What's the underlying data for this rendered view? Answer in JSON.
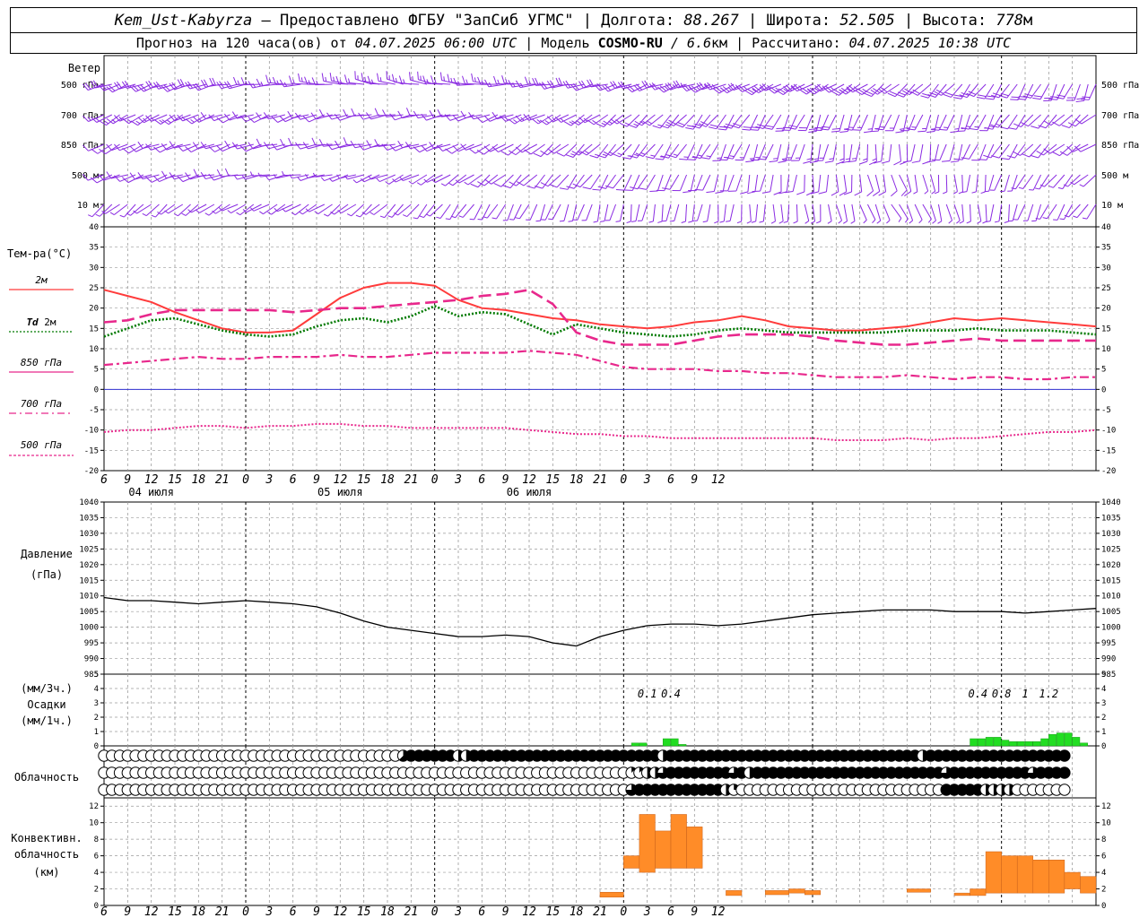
{
  "header": {
    "station": "Kem_Ust-Kabyrza",
    "sep1": " – ",
    "provider": "Предоставлено ФГБУ \"ЗапСиб УГМС\"",
    "lon_label": " | Долгота: ",
    "lon": "88.267",
    "lat_label": " | Широта: ",
    "lat": "52.505",
    "alt_label": " | Высота: ",
    "alt": "778",
    "alt_unit": "м",
    "forecast_prefix": "Прогноз на 120 часа(ов) от ",
    "forecast_time": "04.07.2025 06:00 UTC",
    "model_label": " | Модель ",
    "model": "COSMO-RU",
    "model_res": " / 6.6",
    "model_res_unit": "км",
    "calc_label": " | Рассчитано: ",
    "calc_time": "04.07.2025 10:38 UTC"
  },
  "colors": {
    "wind": "#8a2be2",
    "t2m": "#ff3b3b",
    "td2m": "#007a00",
    "t850": "#e8288c",
    "t700": "#e8288c",
    "t500": "#e8288c",
    "zero": "#3030d0",
    "pressure": "#000000",
    "precip": "#22dd22",
    "conv": "#ff8c28",
    "grid": "#9a9a9a"
  },
  "chart_data": [
    {
      "type": "wind_barbs",
      "title": "Ветер",
      "levels": [
        "500 гПа",
        "700 гПа",
        "850 гПа",
        "500 м",
        "10 м"
      ],
      "step_hours": 1,
      "direction_deg_by_level": [
        [
          250,
          250,
          260,
          270,
          280,
          280,
          270,
          260,
          250,
          250,
          240,
          240,
          230,
          220,
          210,
          200
        ],
        [
          240,
          240,
          250,
          250,
          260,
          260,
          250,
          240,
          230,
          220,
          210,
          200,
          200,
          200,
          220,
          230
        ],
        [
          240,
          250,
          250,
          260,
          260,
          250,
          240,
          230,
          220,
          210,
          200,
          190,
          180,
          200,
          220,
          240
        ],
        [
          250,
          250,
          260,
          260,
          250,
          240,
          230,
          220,
          210,
          200,
          190,
          180,
          160,
          180,
          210,
          230
        ],
        [
          230,
          230,
          240,
          240,
          230,
          220,
          210,
          200,
          190,
          190,
          180,
          170,
          150,
          170,
          200,
          220
        ]
      ],
      "speed_ms_by_level": [
        [
          10,
          10,
          9,
          8,
          8,
          7,
          8,
          9,
          10,
          12,
          13,
          12,
          11,
          10,
          9,
          9
        ],
        [
          7,
          7,
          6,
          6,
          5,
          5,
          6,
          7,
          8,
          9,
          10,
          9,
          8,
          7,
          6,
          6
        ],
        [
          5,
          5,
          5,
          4,
          4,
          4,
          5,
          6,
          7,
          7,
          8,
          7,
          6,
          5,
          4,
          4
        ],
        [
          4,
          4,
          4,
          3,
          3,
          3,
          4,
          4,
          5,
          5,
          6,
          5,
          4,
          3,
          3,
          3
        ],
        [
          2,
          2,
          2,
          2,
          2,
          2,
          2,
          3,
          3,
          3,
          3,
          3,
          2,
          2,
          2,
          2
        ]
      ]
    },
    {
      "type": "line",
      "title": "Тем-ра(°C)",
      "ylim": [
        -20,
        40
      ],
      "yticks": [
        40,
        35,
        30,
        25,
        20,
        15,
        10,
        5,
        0,
        -5,
        -10,
        -15,
        -20
      ],
      "x_hours": [
        0,
        3,
        6,
        9,
        12,
        15,
        18,
        21,
        24,
        27,
        30,
        33,
        36,
        39,
        42,
        45,
        48,
        51,
        54,
        57,
        60,
        63,
        66,
        69,
        72,
        75,
        78,
        81,
        84,
        87,
        90,
        93,
        96,
        99,
        102,
        105,
        108,
        111,
        114,
        117,
        120,
        123,
        126
      ],
      "series": [
        {
          "name": "2м",
          "style": "solid",
          "values": [
            24.5,
            23,
            21.5,
            19,
            17,
            15,
            14,
            14,
            14.5,
            18.5,
            22.5,
            25,
            26.2,
            26.2,
            25.5,
            22,
            20,
            19.5,
            18.5,
            17.5,
            17,
            16,
            15.5,
            15,
            15.5,
            16.5,
            17,
            18,
            17,
            15.5,
            15,
            14.5,
            14.5,
            15,
            15.5,
            16.5,
            17.5,
            17,
            17.5,
            17,
            16.5,
            16,
            15.5
          ]
        },
        {
          "name": "Td 2м",
          "style": "dotted",
          "values": [
            13,
            15,
            17,
            17.5,
            16,
            14.5,
            13.5,
            13,
            13.5,
            15.5,
            17,
            17.5,
            16.5,
            18,
            20.5,
            18,
            19,
            18.5,
            16,
            13.5,
            16,
            15,
            14,
            13.5,
            13,
            13.5,
            14.5,
            15,
            14.5,
            14,
            14,
            14,
            14,
            14,
            14.5,
            14.5,
            14.5,
            15,
            14.5,
            14.5,
            14.5,
            14,
            13.5
          ]
        },
        {
          "name": "850 гПа",
          "style": "longdash",
          "values": [
            16.5,
            17,
            18.5,
            19.5,
            19.5,
            19.5,
            19.5,
            19.5,
            19,
            19.5,
            20,
            20,
            20.5,
            21,
            21.5,
            22,
            23,
            23.5,
            24.5,
            21,
            14,
            12,
            11,
            11,
            11,
            12,
            13,
            13.5,
            13.5,
            13.5,
            13,
            12,
            11.5,
            11,
            11,
            11.5,
            12,
            12.5,
            12,
            12,
            12,
            12,
            12
          ]
        },
        {
          "name": "700 гПа",
          "style": "dashdot",
          "values": [
            6,
            6.5,
            7,
            7.5,
            8,
            7.5,
            7.5,
            8,
            8,
            8,
            8.5,
            8,
            8,
            8.5,
            9,
            9,
            9,
            9,
            9.5,
            9,
            8.5,
            7,
            5.5,
            5,
            5,
            5,
            4.5,
            4.5,
            4,
            4,
            3.5,
            3,
            3,
            3,
            3.5,
            3,
            2.5,
            3,
            3,
            2.5,
            2.5,
            3,
            3
          ]
        },
        {
          "name": "500 гПа",
          "style": "dotted",
          "values": [
            -10.5,
            -10,
            -10,
            -9.5,
            -9,
            -9,
            -9.5,
            -9,
            -9,
            -8.5,
            -8.5,
            -9,
            -9,
            -9.5,
            -9.5,
            -9.5,
            -9.5,
            -9.5,
            -10,
            -10.5,
            -11,
            -11,
            -11.5,
            -11.5,
            -12,
            -12,
            -12,
            -12,
            -12,
            -12,
            -12,
            -12.5,
            -12.5,
            -12.5,
            -12,
            -12.5,
            -12,
            -12,
            -11.5,
            -11,
            -10.5,
            -10.5,
            -10
          ]
        }
      ]
    },
    {
      "type": "line",
      "title": "Давление (гПа)",
      "ylim": [
        985,
        1040
      ],
      "yticks": [
        1040,
        1035,
        1030,
        1025,
        1020,
        1015,
        1010,
        1005,
        1000,
        995,
        990,
        985
      ],
      "x_hours": [
        0,
        3,
        6,
        9,
        12,
        15,
        18,
        21,
        24,
        27,
        30,
        33,
        36,
        39,
        42,
        45,
        48,
        51,
        54,
        57,
        60,
        63,
        66,
        69,
        72,
        75,
        78,
        81,
        84,
        87,
        90,
        93,
        96,
        99,
        102,
        105,
        108,
        111,
        114,
        117,
        120,
        123,
        126
      ],
      "series": [
        {
          "name": "",
          "style": "solid",
          "values": [
            1009.5,
            1008.5,
            1008.5,
            1008,
            1007.5,
            1008,
            1008.5,
            1008,
            1007.5,
            1006.5,
            1004.5,
            1002,
            1000,
            999,
            998,
            997,
            997,
            997.5,
            997,
            995,
            994,
            997,
            999,
            1000.5,
            1001,
            1001,
            1000.5,
            1001,
            1002,
            1003,
            1004,
            1004.5,
            1005,
            1005.5,
            1005.5,
            1005.5,
            1005,
            1005,
            1005,
            1004.5,
            1005,
            1005.5,
            1006
          ]
        }
      ]
    },
    {
      "type": "bar",
      "title": "Осадки",
      "ylabel_top": "(мм/3ч.)",
      "ylabel_bottom": "(мм/1ч.)",
      "ylim": [
        0,
        5
      ],
      "yticks": [
        5,
        4,
        3,
        2,
        1,
        0
      ],
      "step_hours": 1,
      "start_hour": 66,
      "values": [
        0,
        0.2,
        0.2,
        0,
        0,
        0.5,
        0.5,
        0.1,
        0,
        0
      ],
      "late_start_hour": 110,
      "late_values": [
        0.5,
        0.5,
        0.6,
        0.6,
        0.4,
        0.3,
        0.3,
        0.3,
        0.3,
        0.5,
        0.8,
        0.9,
        0.9,
        0.6,
        0.2
      ],
      "sum_labels": [
        {
          "hour": 69,
          "text": "0.1"
        },
        {
          "hour": 72,
          "text": "0.4"
        },
        {
          "hour": 111,
          "text": "0.4"
        },
        {
          "hour": 114,
          "text": "0.8"
        },
        {
          "hour": 117,
          "text": "1"
        },
        {
          "hour": 120,
          "text": "1.2"
        }
      ]
    },
    {
      "type": "table",
      "title": "Облачность",
      "step_hours": 1,
      "rows": [
        "000000000000000000000000000000000000005888888448888888888888888888888884888888888888888888888888888888884888888888888888888",
        "000000000000000000000000000000000000000000000000000000000000000000011446888888886848888888888888888888888886888888888868888",
        "000000000000000000000000000000000000000000000000000000000000000000068888888888842000000000000000000000000008888844440000000"
      ]
    },
    {
      "type": "bar",
      "title": "Конвективн. облачность (км)",
      "ylim": [
        0,
        13
      ],
      "yticks": [
        12,
        10,
        8,
        6,
        4,
        2,
        0
      ],
      "bars": [
        {
          "h0": 63,
          "h1": 66,
          "lo": 1,
          "hi": 1.6
        },
        {
          "h0": 66,
          "h1": 68,
          "lo": 4.5,
          "hi": 6
        },
        {
          "h0": 68,
          "h1": 70,
          "lo": 4,
          "hi": 11
        },
        {
          "h0": 70,
          "h1": 72,
          "lo": 4.5,
          "hi": 9
        },
        {
          "h0": 72,
          "h1": 74,
          "lo": 4.5,
          "hi": 11
        },
        {
          "h0": 74,
          "h1": 76,
          "lo": 4.5,
          "hi": 9.5
        },
        {
          "h0": 79,
          "h1": 81,
          "lo": 1.2,
          "hi": 1.8
        },
        {
          "h0": 84,
          "h1": 87,
          "lo": 1.3,
          "hi": 1.8
        },
        {
          "h0": 87,
          "h1": 89,
          "lo": 1.5,
          "hi": 2
        },
        {
          "h0": 89,
          "h1": 91,
          "lo": 1.3,
          "hi": 1.8
        },
        {
          "h0": 102,
          "h1": 105,
          "lo": 1.6,
          "hi": 2
        },
        {
          "h0": 108,
          "h1": 110,
          "lo": 1.2,
          "hi": 1.5
        },
        {
          "h0": 110,
          "h1": 112,
          "lo": 1.2,
          "hi": 2
        },
        {
          "h0": 112,
          "h1": 114,
          "lo": 1.5,
          "hi": 6.5
        },
        {
          "h0": 114,
          "h1": 116,
          "lo": 1.5,
          "hi": 6
        },
        {
          "h0": 116,
          "h1": 118,
          "lo": 1.5,
          "hi": 6
        },
        {
          "h0": 118,
          "h1": 120,
          "lo": 1.5,
          "hi": 5.5
        },
        {
          "h0": 120,
          "h1": 122,
          "lo": 1.5,
          "hi": 5.5
        },
        {
          "h0": 122,
          "h1": 124,
          "lo": 2,
          "hi": 4
        },
        {
          "h0": 124,
          "h1": 126,
          "lo": 1.5,
          "hi": 3.5
        }
      ]
    }
  ],
  "time_axis": {
    "tick_labels": [
      "6",
      "9",
      "12",
      "15",
      "18",
      "21",
      "0",
      "3",
      "6",
      "9",
      "12",
      "15",
      "18",
      "21",
      "0",
      "3",
      "6",
      "9",
      "12",
      "15",
      "18",
      "21",
      "0",
      "3",
      "6",
      "9",
      "12"
    ],
    "day_labels": [
      "04 июля",
      "05 июля",
      "06 июля"
    ]
  },
  "legend": {
    "t2m": "2м",
    "td_prefix": "Td",
    "td_suffix": " 2м",
    "t850": "850 гПа",
    "t700": "700 гПа",
    "t500": "500 гПа"
  },
  "labels": {
    "wind": "Ветер",
    "temp": "Тем-ра(°C)",
    "pressure": "Давление",
    "pressure_unit": "(гПа)",
    "precip_top": "(мм/3ч.)",
    "precip": "Осадки",
    "precip_bottom": "(мм/1ч.)",
    "cloud": "Облачность",
    "conv1": "Конвективн.",
    "conv2": "облачность",
    "conv3": "(км)"
  }
}
